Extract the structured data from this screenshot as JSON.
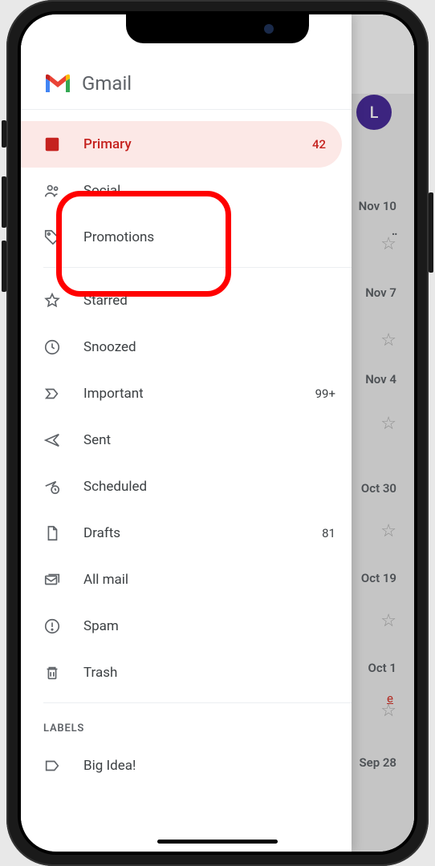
{
  "app": {
    "name": "Gmail"
  },
  "avatar": {
    "initial": "L"
  },
  "categories": {
    "primary": {
      "label": "Primary",
      "count": "42",
      "active": true
    },
    "social": {
      "label": "Social"
    },
    "promotions": {
      "label": "Promotions"
    }
  },
  "folders": {
    "starred": {
      "label": "Starred"
    },
    "snoozed": {
      "label": "Snoozed"
    },
    "important": {
      "label": "Important",
      "count": "99+"
    },
    "sent": {
      "label": "Sent"
    },
    "scheduled": {
      "label": "Scheduled"
    },
    "drafts": {
      "label": "Drafts",
      "count": "81"
    },
    "allmail": {
      "label": "All mail"
    },
    "spam": {
      "label": "Spam"
    },
    "trash": {
      "label": "Trash"
    }
  },
  "labelsHeading": "LABELS",
  "labels": {
    "bigidea": {
      "label": "Big Idea!"
    }
  },
  "emails": {
    "0": {
      "date": "Nov 10"
    },
    "1": {
      "date": "Nov 7"
    },
    "2": {
      "date": "Nov 4"
    },
    "3": {
      "date": "Oct 30"
    },
    "4": {
      "date": "Oct 19"
    },
    "5": {
      "date": "Oct 1"
    },
    "6": {
      "date": "Sep 28"
    }
  },
  "unsubscribe_hint": "e"
}
